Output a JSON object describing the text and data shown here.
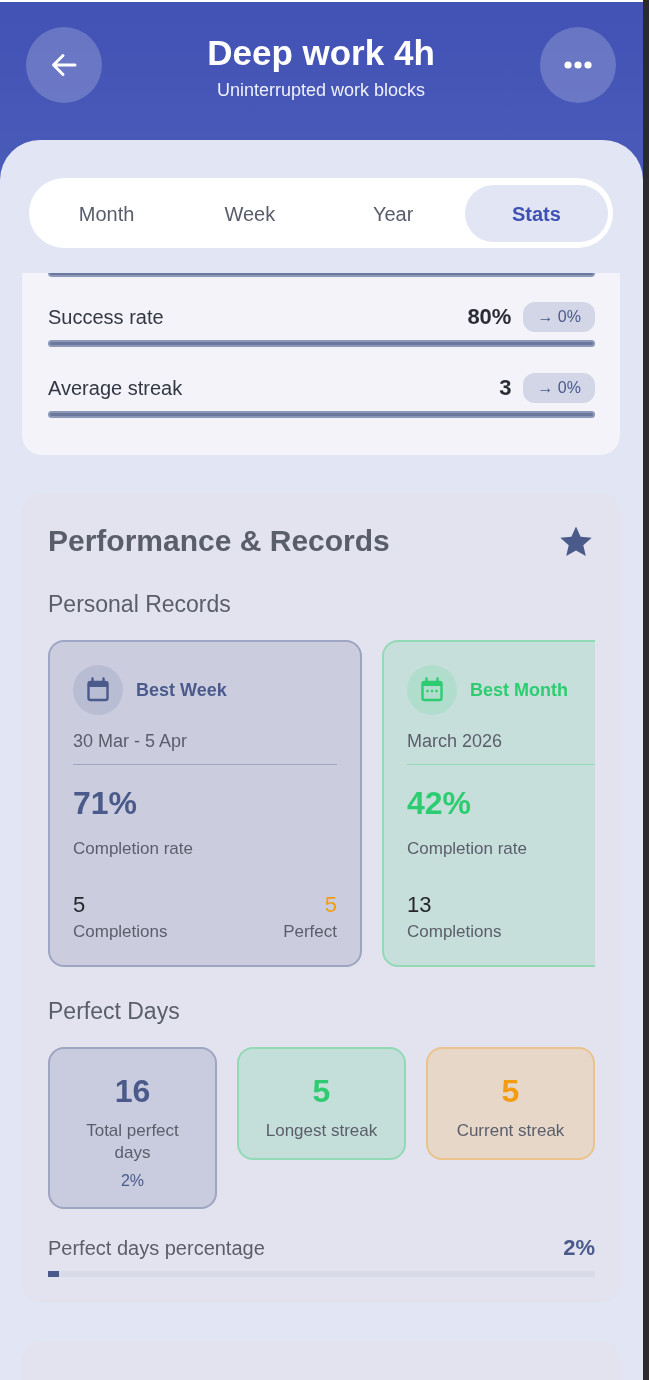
{
  "header": {
    "title": "Deep work 4h",
    "subtitle": "Uninterrupted work blocks"
  },
  "tabs": [
    {
      "label": "Month",
      "selected": false
    },
    {
      "label": "Week",
      "selected": false
    },
    {
      "label": "Year",
      "selected": false
    },
    {
      "label": "Stats",
      "selected": true
    }
  ],
  "stats": {
    "metrics": [
      {
        "level": 1
      },
      {
        "label": "Success rate",
        "value": "80%",
        "change": "→ 0%",
        "level": 1
      },
      {
        "label": "Average streak",
        "value": "3",
        "change": "→ 0%",
        "level": 1
      }
    ]
  },
  "performance": {
    "title": "Performance & Records",
    "records_title": "Personal Records",
    "records": [
      {
        "kind": "week",
        "title": "Best Week",
        "period": "30 Mar - 5 Apr",
        "rate": "71%",
        "rate_label": "Completion rate",
        "color": "#4a5a8a",
        "stats": [
          {
            "value": "5",
            "label": "Completions",
            "color": "#25262b"
          },
          {
            "value": "5",
            "label": "Perfect",
            "color": "#f39c12"
          }
        ]
      },
      {
        "kind": "month",
        "title": "Best Month",
        "period": "March 2026",
        "rate": "42%",
        "rate_label": "Completion rate",
        "color": "#2ecc71",
        "stats": [
          {
            "value": "13",
            "label": "Completions",
            "color": "#25262b"
          }
        ]
      }
    ],
    "perfect_days_title": "Perfect Days",
    "perfect_days": [
      {
        "value": "16",
        "label": "Total perfect days",
        "note": "2%",
        "color": "#4a5a8a"
      },
      {
        "value": "5",
        "label": "Longest streak",
        "color": "#2ecc71"
      },
      {
        "value": "5",
        "label": "Current streak",
        "color": "#f39c12"
      }
    ],
    "percentage": {
      "label": "Perfect days percentage",
      "value": "2%",
      "level": 0.02
    }
  }
}
